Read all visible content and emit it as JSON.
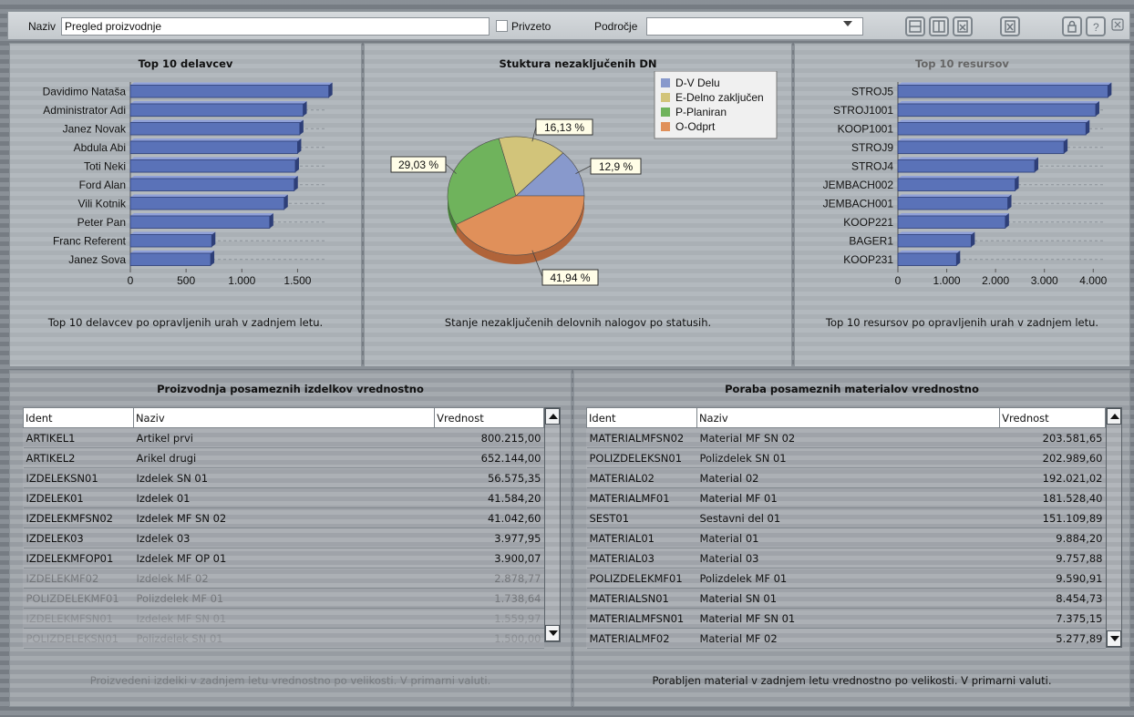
{
  "toolbar": {
    "name_label": "Naziv",
    "name_value": "Pregled proizvodnje",
    "pinned_label": "Privzeto",
    "area_label": "Področje",
    "area_value": ""
  },
  "workers_panel": {
    "title": "Top 10 delavcev",
    "caption": "Top 10 delavcev po opravljenih urah v zadnjem letu."
  },
  "status_panel": {
    "title": "Stuktura nezaključenih DN",
    "caption": "Stanje nezaključenih delovnih nalogov po statusih."
  },
  "resources_panel": {
    "title": "Top 10 resursov",
    "caption": "Top 10 resursov po opravljenih urah v zadnjem letu."
  },
  "products_panel": {
    "title": "Proizvodnja posameznih izdelkov vrednostno",
    "caption": "Proizvedeni izdelki v zadnjem letu vrednostno po velikosti. V primarni valuti.",
    "columns": [
      "Ident",
      "Naziv",
      "Vrednost"
    ],
    "rows": [
      [
        "ARTIKEL1",
        "Artikel prvi",
        "800.215,00"
      ],
      [
        "ARTIKEL2",
        "Arikel drugi",
        "652.144,00"
      ],
      [
        "IZDELEKSN01",
        "Izdelek SN 01",
        "56.575,35"
      ],
      [
        "IZDELEK01",
        "Izdelek 01",
        "41.584,20"
      ],
      [
        "IZDELEKMFSN02",
        "Izdelek MF SN 02",
        "41.042,60"
      ],
      [
        "IZDELEK03",
        "Izdelek 03",
        "3.977,95"
      ],
      [
        "IZDELEKMFOP01",
        "Izdelek MF OP 01",
        "3.900,07"
      ],
      [
        "IZDELEKMF02",
        "Izdelek MF 02",
        "2.878,77"
      ],
      [
        "POLIZDELEKMF01",
        "Polizdelek MF 01",
        "1.738,64"
      ],
      [
        "IZDELEKMFSN01",
        "Izdelek MF SN 01",
        "1.559,97"
      ],
      [
        "POLIZDELEKSN01",
        "Polizdelek SN 01",
        "1.500,00"
      ]
    ]
  },
  "materials_panel": {
    "title": "Poraba posameznih materialov vrednostno",
    "caption": "Porabljen material v zadnjem letu vrednostno po velikosti. V primarni valuti.",
    "columns": [
      "Ident",
      "Naziv",
      "Vrednost"
    ],
    "rows": [
      [
        "MATERIALMFSN02",
        "Material MF SN 02",
        "203.581,65"
      ],
      [
        "POLIZDELEKSN01",
        "Polizdelek SN 01",
        "202.989,60"
      ],
      [
        "MATERIAL02",
        "Material 02",
        "192.021,02"
      ],
      [
        "MATERIALMF01",
        "Material MF 01",
        "181.528,40"
      ],
      [
        "SEST01",
        "Sestavni del 01",
        "151.109,89"
      ],
      [
        "MATERIAL01",
        "Material 01",
        "9.884,20"
      ],
      [
        "MATERIAL03",
        "Material 03",
        "9.757,88"
      ],
      [
        "POLIZDELEKMF01",
        "Polizdelek MF 01",
        "9.590,91"
      ],
      [
        "MATERIALSN01",
        "Material SN 01",
        "8.454,73"
      ],
      [
        "MATERIALMFSN01",
        "Material MF SN 01",
        "7.375,15"
      ],
      [
        "MATERIALMF02",
        "Material MF 02",
        "5.277,89"
      ]
    ]
  },
  "colors": {
    "bar": "#5a72b8",
    "pie_dv": "#8899cc",
    "pie_e": "#d2c47a",
    "pie_p": "#6fb35c",
    "pie_o": "#e0905a"
  },
  "chart_data": [
    {
      "type": "bar",
      "orientation": "horizontal",
      "categories": [
        "Davidimo Nataša",
        "Administrator Adi",
        "Janez Novak",
        "Abdula Abi",
        "Toti Neki",
        "Ford Alan",
        "Vili Kotnik",
        "Peter Pan",
        "Franc Referent",
        "Janez Sova"
      ],
      "values": [
        1780,
        1550,
        1520,
        1500,
        1480,
        1470,
        1380,
        1250,
        730,
        720
      ],
      "xlim": [
        0,
        1750
      ],
      "xticks": [
        "0",
        "500",
        "1.000",
        "1.500"
      ]
    },
    {
      "type": "pie",
      "labels": [
        "D-V Delu",
        "E-Delno zaključen",
        "P-Planiran",
        "O-Odprt"
      ],
      "values": [
        12.9,
        16.13,
        29.03,
        41.94
      ],
      "value_labels": [
        "12,9 %",
        "16,13 %",
        "29,03 %",
        "41,94 %"
      ],
      "legend": "top-right"
    },
    {
      "type": "bar",
      "orientation": "horizontal",
      "categories": [
        "STROJ5",
        "STROJ1001",
        "KOOP1001",
        "STROJ9",
        "STROJ4",
        "JEMBACH002",
        "JEMBACH001",
        "KOOP221",
        "BAGER1",
        "KOOP231"
      ],
      "values": [
        4300,
        4050,
        3850,
        3400,
        2800,
        2400,
        2250,
        2200,
        1500,
        1200
      ],
      "xlim": [
        0,
        4200
      ],
      "xticks": [
        "0",
        "1.000",
        "2.000",
        "3.000",
        "4.000"
      ]
    }
  ]
}
